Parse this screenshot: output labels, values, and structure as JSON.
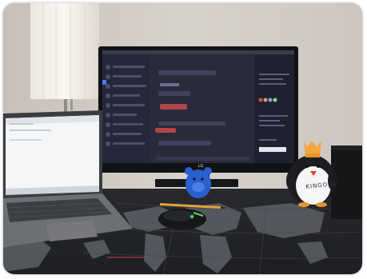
{
  "photo": {
    "monitor_brand": "LG",
    "mascot_text": "KINGOIN"
  },
  "colors": {
    "wall": "#cfc8c2",
    "desk_mat": "#2b2d31",
    "map_land": "#5d6066",
    "monitor_screen": "#2a2b3a",
    "laptop_screen": "#f4f6f8",
    "mouse_accent": "#5bd85b",
    "plush_blue": "#2c5fcf",
    "penguin_crown": "#f2a63b"
  }
}
